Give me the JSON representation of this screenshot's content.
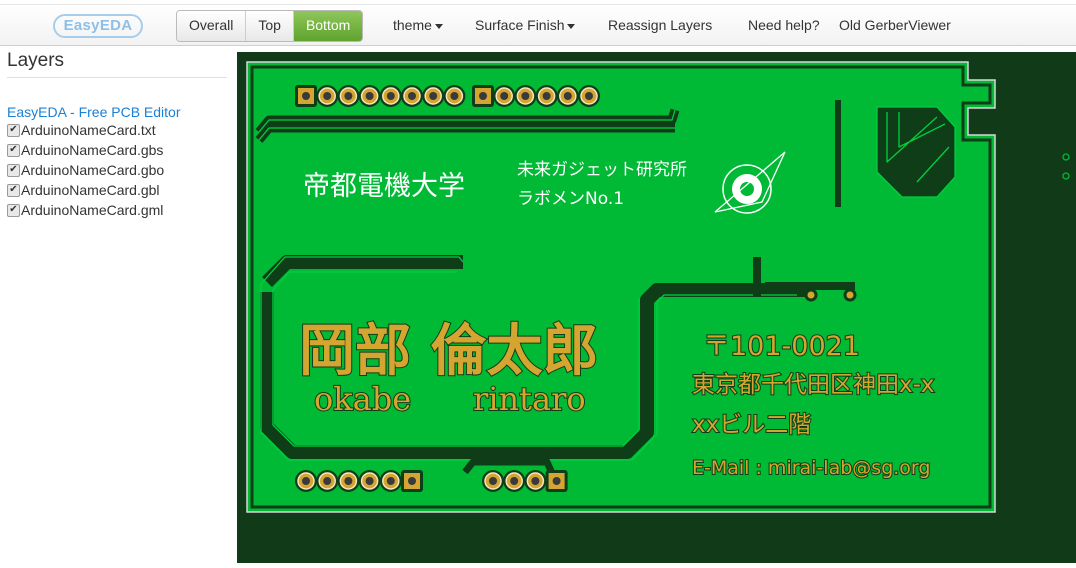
{
  "header": {
    "logo_text": "EasyEDA",
    "view_buttons": [
      {
        "label": "Overall",
        "active": false
      },
      {
        "label": "Top",
        "active": false
      },
      {
        "label": "Bottom",
        "active": true
      }
    ],
    "menu": {
      "theme": "theme",
      "surface_finish": "Surface Finish",
      "reassign_layers": "Reassign Layers",
      "need_help": "Need help?",
      "old_viewer": "Old GerberViewer"
    }
  },
  "sidebar": {
    "title": "Layers",
    "link": "EasyEDA - Free PCB Editor",
    "layers": [
      {
        "name": "ArduinoNameCard.txt",
        "checked": true
      },
      {
        "name": "ArduinoNameCard.gbs",
        "checked": true
      },
      {
        "name": "ArduinoNameCard.gbo",
        "checked": true
      },
      {
        "name": "ArduinoNameCard.gbl",
        "checked": true
      },
      {
        "name": "ArduinoNameCard.gml",
        "checked": true
      }
    ]
  },
  "board": {
    "colors": {
      "background": "#103a18",
      "mask": "#00b935",
      "trace": "#0f3d18",
      "pad": "#d4a530",
      "silk": "#ffffff"
    },
    "university": "帝都電機大学",
    "lab": "未来ガジェット研究所",
    "member": "ラボメンNo.1",
    "name_jp": "岡部 倫太郎",
    "name_first": "okabe",
    "name_last": "rintaro",
    "postal": "〒101-0021",
    "address1": "東京都千代田区神田x-x",
    "address2": "xxビル二階",
    "email": "E-Mail : mirai-lab@sg.org"
  }
}
